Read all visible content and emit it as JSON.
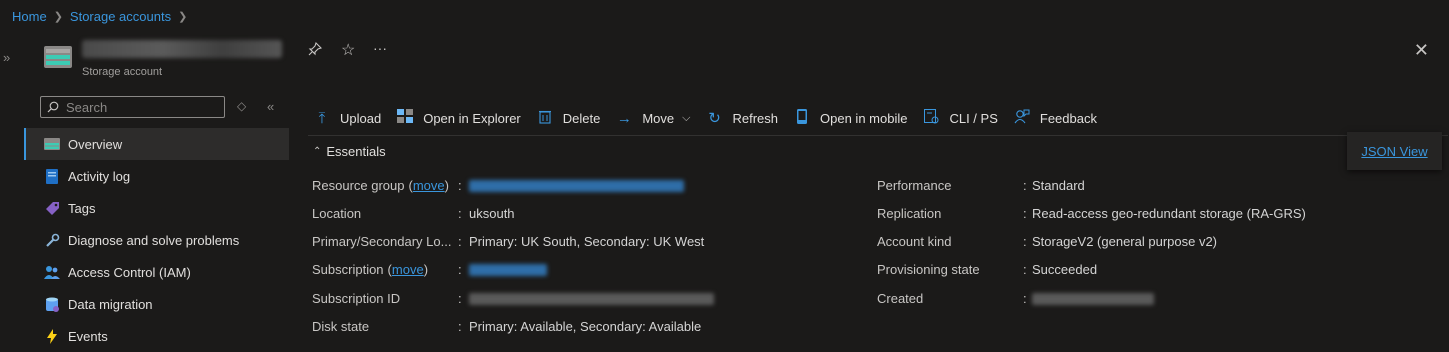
{
  "breadcrumb": [
    "Home",
    "Storage accounts"
  ],
  "resource": {
    "type": "Storage account"
  },
  "search": {
    "placeholder": "Search"
  },
  "menu": [
    {
      "label": "Overview",
      "icon": "storage-icon",
      "active": true
    },
    {
      "label": "Activity log",
      "icon": "activity-log-icon"
    },
    {
      "label": "Tags",
      "icon": "tag-icon"
    },
    {
      "label": "Diagnose and solve problems",
      "icon": "wrench-icon"
    },
    {
      "label": "Access Control (IAM)",
      "icon": "people-icon"
    },
    {
      "label": "Data migration",
      "icon": "database-icon"
    },
    {
      "label": "Events",
      "icon": "lightning-icon"
    }
  ],
  "commands": [
    {
      "label": "Upload",
      "icon": "upload-icon"
    },
    {
      "label": "Open in Explorer",
      "icon": "explorer-icon"
    },
    {
      "label": "Delete",
      "icon": "trash-icon"
    },
    {
      "label": "Move",
      "icon": "arrow-right-icon"
    },
    {
      "label": "Refresh",
      "icon": "refresh-icon"
    },
    {
      "label": "Open in mobile",
      "icon": "mobile-icon"
    },
    {
      "label": "CLI / PS",
      "icon": "terminal-icon"
    },
    {
      "label": "Feedback",
      "icon": "feedback-icon"
    }
  ],
  "essentials": {
    "title": "Essentials",
    "json_view": "JSON View",
    "left": [
      {
        "label": "Resource group",
        "move": "move",
        "value": ""
      },
      {
        "label": "Location",
        "value": "uksouth"
      },
      {
        "label": "Primary/Secondary Lo...",
        "value": "Primary: UK South, Secondary: UK West"
      },
      {
        "label": "Subscription",
        "move": "move",
        "value": ""
      },
      {
        "label": "Subscription ID",
        "value": ""
      },
      {
        "label": "Disk state",
        "value": "Primary: Available, Secondary: Available"
      }
    ],
    "right": [
      {
        "label": "Performance",
        "value": "Standard"
      },
      {
        "label": "Replication",
        "value": "Read-access geo-redundant storage (RA-GRS)"
      },
      {
        "label": "Account kind",
        "value": "StorageV2 (general purpose v2)"
      },
      {
        "label": "Provisioning state",
        "value": "Succeeded"
      },
      {
        "label": "Created",
        "value": ""
      }
    ]
  },
  "colors": {
    "accent": "#3a96dd",
    "background": "#1b1a19"
  }
}
